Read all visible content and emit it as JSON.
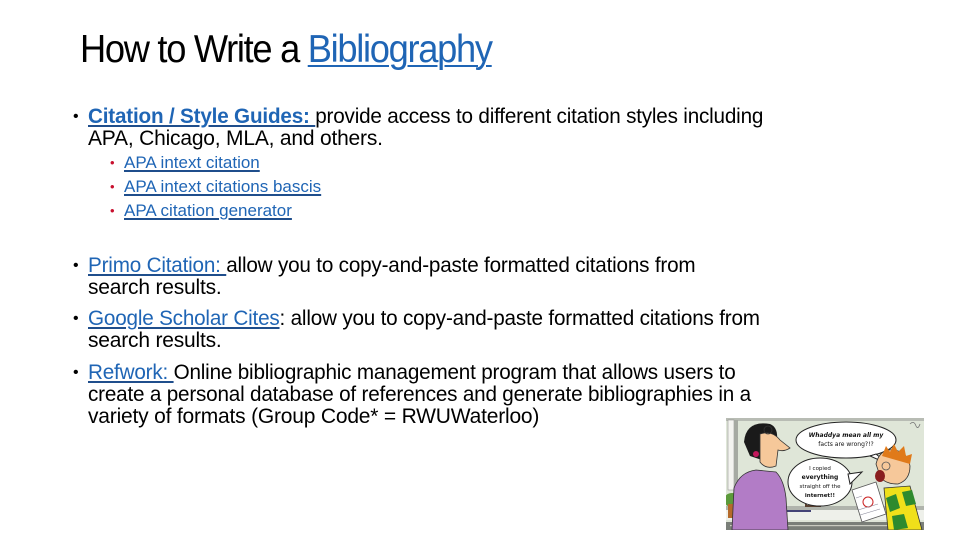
{
  "title": {
    "prefix": "How to Write a ",
    "link": "Bibliography"
  },
  "bullets": [
    {
      "link": "Citation / Style Guides: ",
      "line1_rest": "provide access to different citation styles including",
      "line2": "APA, Chicago, MLA, and others.",
      "sub_items": [
        {
          "label": "APA intext citation"
        },
        {
          "label": "APA intext citations bascis"
        },
        {
          "label": "APA citation generator"
        }
      ]
    },
    {
      "link": "Primo Citation: ",
      "line1_rest": "allow you to copy-and-paste formatted citations from",
      "line2": "search results."
    },
    {
      "link": "Google Scholar Cites",
      "line1_rest": ": allow you to copy-and-paste formatted citations from",
      "line2": "search results."
    },
    {
      "link": "Refwork: ",
      "line1_rest": "Online bibliographic management program that allows users to",
      "line2": "create a personal database of references and generate bibliographies in a",
      "line3": "variety of formats (Group Code* = RWUWaterloo)"
    }
  ],
  "cartoon": {
    "bubble_top": [
      "Whaddya mean all my",
      "facts are wrong?!?"
    ],
    "bubble_left": [
      "I copied",
      "everything",
      "straight off the",
      "internet!!"
    ]
  },
  "colors": {
    "link": "#1f65b5",
    "link_underline": "#1f4e8c",
    "sub_bullet": "#c8102e",
    "text": "#000000"
  }
}
